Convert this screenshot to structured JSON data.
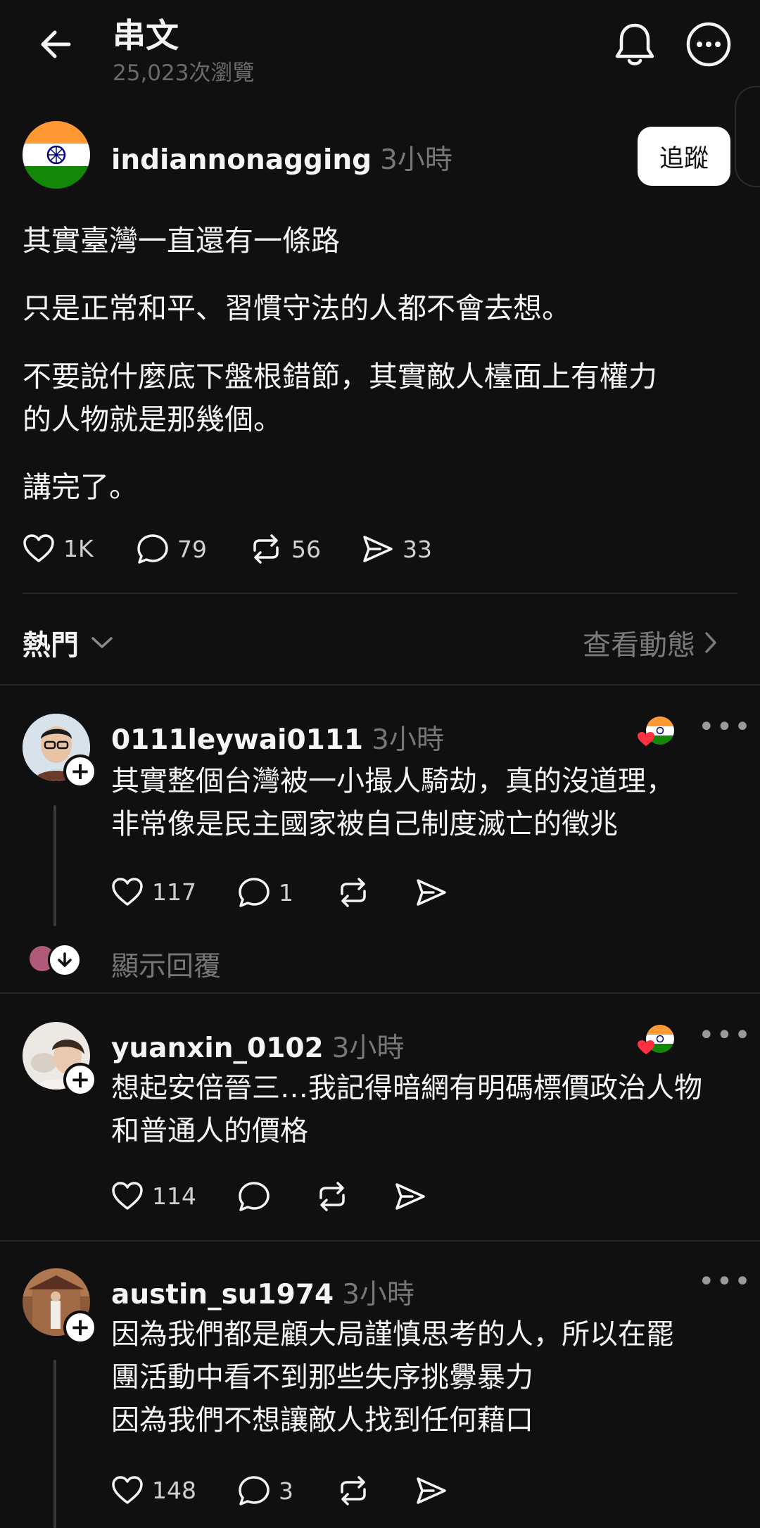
{
  "header": {
    "title": "串文",
    "views": "25,023次瀏覽"
  },
  "post": {
    "username": "indiannonagging",
    "time": "3小時",
    "follow_label": "追蹤",
    "lines": [
      "其實臺灣一直還有一條路",
      "只是正常和平、習慣守法的人都不會去想。",
      "不要說什麼底下盤根錯節，其實敵人檯面上有權力",
      "的人物就是那幾個。",
      "講完了。"
    ],
    "stats": {
      "likes": "1K",
      "comments": "79",
      "reposts": "56",
      "shares": "33"
    }
  },
  "sort": {
    "label": "熱門",
    "activity_label": "查看動態"
  },
  "comments": [
    {
      "username": "0111leywai0111",
      "time": "3小時",
      "lines": [
        "其實整個台灣被一小撮人騎劫，真的沒道理，",
        "非常像是民主國家被自己制度滅亡的徵兆"
      ],
      "likes": "117",
      "comments": "1",
      "show_replies": "顯示回覆"
    },
    {
      "username": "yuanxin_0102",
      "time": "3小時",
      "lines": [
        "想起安倍晉三…我記得暗網有明碼標價政治人物",
        "和普通人的價格"
      ],
      "likes": "114",
      "comments": ""
    },
    {
      "username": "austin_su1974",
      "time": "3小時",
      "lines": [
        "因為我們都是顧大局謹慎思考的人，所以在罷",
        "團活動中看不到那些失序挑釁暴力",
        "因為我們不想讓敵人找到任何藉口"
      ],
      "likes": "148",
      "comments": "3"
    }
  ],
  "colors": {
    "background": "#101010",
    "text": "#f3f5f7",
    "muted": "#777777",
    "heart": "#ff3040"
  },
  "icons": [
    "back-arrow-icon",
    "bell-icon",
    "more-icon",
    "heart-icon",
    "comment-icon",
    "repost-icon",
    "share-icon",
    "chevron-down-icon",
    "chevron-right-icon",
    "india-flag-icon"
  ]
}
